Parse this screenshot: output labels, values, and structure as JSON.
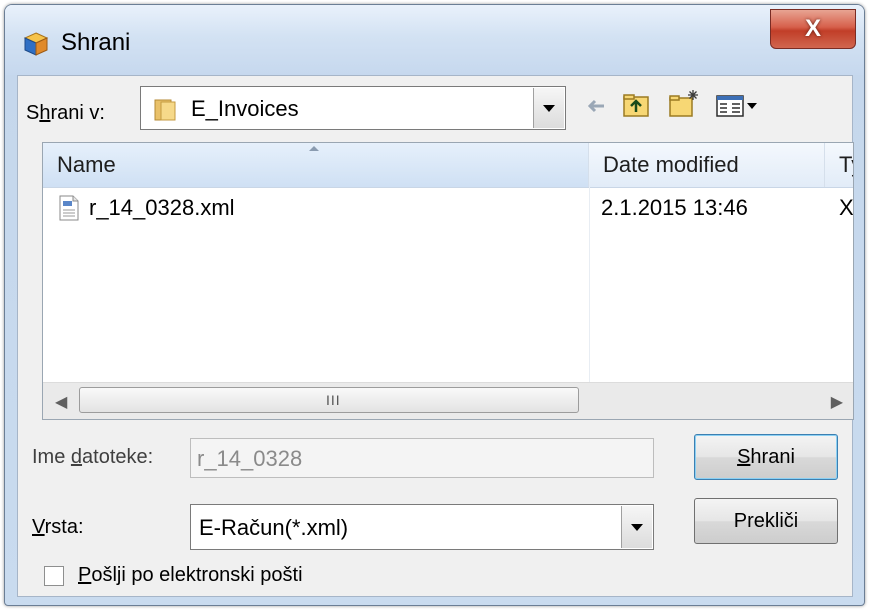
{
  "window": {
    "title": "Shrani",
    "close_glyph": "X"
  },
  "save_in": {
    "label_pre": "S",
    "label_u": "h",
    "label_post": "rani v:",
    "folder": "E_Invoices",
    "folder_icon": "folder-icon"
  },
  "toolbar": {
    "back_icon": "back-arrow-icon",
    "up_icon": "up-folder-icon",
    "new_folder_icon": "new-folder-icon",
    "view_menu_icon": "view-menu-icon"
  },
  "list": {
    "columns": [
      "Name",
      "Date modified",
      "Ty"
    ],
    "rows": [
      {
        "name": "r_14_0328.xml",
        "date": "2.1.2015 13:46",
        "type": "XI",
        "icon": "xml-file-icon"
      }
    ],
    "scroll_grip": "III"
  },
  "filename": {
    "label_pre": "Ime ",
    "label_u": "d",
    "label_post": "atoteke:",
    "value": "r_14_0328"
  },
  "filetype": {
    "label_u": "V",
    "label_post": "rsta:",
    "value": "E-Račun(*.xml)"
  },
  "buttons": {
    "save_u": "S",
    "save_post": "hrani",
    "cancel": "Prekliči"
  },
  "email_checkbox": {
    "label_u": "P",
    "label_post": "ošlji po elektronski pošti",
    "checked": false
  },
  "colors": {
    "accent_close": "#c13e28",
    "title_bar": "#d3e2f3",
    "dialog_bg": "#f0f0f0",
    "header_sorted": "#cfe0f4"
  }
}
